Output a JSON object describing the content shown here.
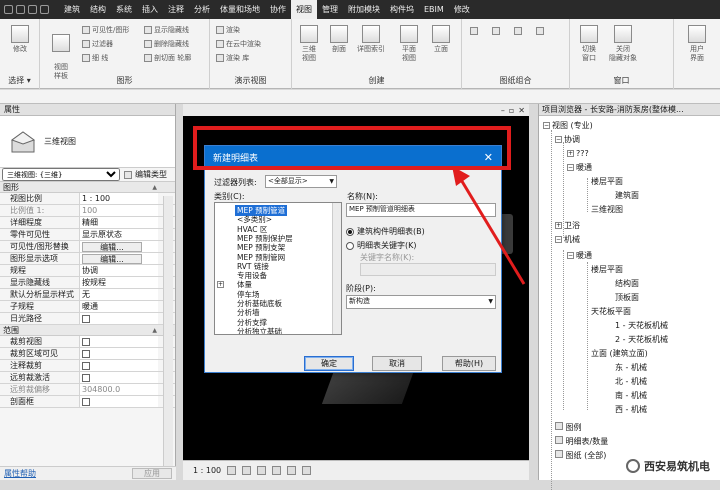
{
  "menubar": {
    "items": [
      "建筑",
      "结构",
      "系统",
      "插入",
      "注释",
      "分析",
      "体量和场地",
      "协作",
      "视图",
      "管理",
      "附加模块",
      "构件坞",
      "EBIM",
      "修改"
    ],
    "active": "视图"
  },
  "ribbon": {
    "modify": "修改",
    "select": "选择 ▾",
    "graphics": {
      "view_template": "视图\n样板",
      "visibility": "可见性/图形",
      "filters": "过滤器",
      "thin_lines": "细 线",
      "show_hidden": "显示隐藏线",
      "remove_hidden": "删除隐藏线",
      "cut_profile": "剖切面 轮廓",
      "label": "图形"
    },
    "presentation": {
      "render": "渲染",
      "render_cloud": "在云中渲染",
      "render_gallery": "渲染 库",
      "label": "演示视图"
    },
    "create": {
      "three_d": "三维\n视图",
      "section": "剖面",
      "callout": "详图索引",
      "plan_views": "平面\n视图",
      "elevation": "立面",
      "label": "创建"
    },
    "sheet": {
      "label": "图纸组合"
    },
    "window": {
      "switch": "切换\n窗口",
      "close_inactive": "关闭\n隐藏对象",
      "user_interface": "用户\n界面",
      "label": "窗口"
    }
  },
  "properties": {
    "title": "属性",
    "type_name": "三维视图",
    "selector": "三维视图: {三维}",
    "edit_type": "编辑类型",
    "group_graphics": "图形",
    "group_range": "范围",
    "rows_graphics": [
      {
        "k": "视图比例",
        "v": "1 : 100"
      },
      {
        "k": "比例值 1:",
        "v": "100"
      },
      {
        "k": "详细程度",
        "v": "精细"
      },
      {
        "k": "零件可见性",
        "v": "显示原状态"
      },
      {
        "k": "可见性/图形替换",
        "v": "编辑..."
      },
      {
        "k": "图形显示选项",
        "v": "编辑..."
      },
      {
        "k": "规程",
        "v": "协调"
      },
      {
        "k": "显示隐藏线",
        "v": "按规程"
      },
      {
        "k": "默认分析显示样式",
        "v": "无"
      },
      {
        "k": "子规程",
        "v": "暖通"
      },
      {
        "k": "日光路径",
        "v": ""
      }
    ],
    "rows_range": [
      {
        "k": "裁剪视图",
        "v": ""
      },
      {
        "k": "裁剪区域可见",
        "v": ""
      },
      {
        "k": "注释裁剪",
        "v": ""
      },
      {
        "k": "远剪裁激活",
        "v": ""
      },
      {
        "k": "远剪裁偏移",
        "v": "304800.0"
      },
      {
        "k": "剖面框",
        "v": ""
      }
    ],
    "help": "属性帮助",
    "apply": "应用"
  },
  "status": {
    "scale": "1 : 100"
  },
  "browser": {
    "title": "项目浏览器 - 长安路-消防泵房(整体模...",
    "nodes": {
      "views": "视图 (专业)",
      "coord": "协调",
      "q": "???",
      "hvac1": "暖通",
      "floorplan1": "楼层平面",
      "arch_plan": "建筑面",
      "view3d": "三维视图",
      "plumbing": "卫浴",
      "mech": "机械",
      "hvac2": "暖通",
      "floorplan2": "楼层平面",
      "struct_plan": "结构面",
      "roof_plan": "顶板面",
      "ceiling": "天花板平面",
      "ceil1": "1 - 天花板机械",
      "ceil2": "2 - 天花板机械",
      "elev": "立面 (建筑立面)",
      "east": "东 - 机械",
      "north": "北 - 机械",
      "south": "南 - 机械",
      "west": "西 - 机械",
      "legends": "图例",
      "schedules": "明细表/数量",
      "sheets": "图纸 (全部)"
    },
    "watermark": "西安易筑机电"
  },
  "dialog": {
    "title": "新建明细表",
    "filter_label": "过滤器列表:",
    "filter_value": "<全部显示>",
    "category_label": "类别(C):",
    "categories": [
      "MEP 预制管道",
      "<多类别>",
      "HVAC 区",
      "MEP 预制保护层",
      "MEP 预制支架",
      "MEP 预制管网",
      "RVT 链接",
      "专用设备",
      "体量",
      "停车场",
      "分析基础底板",
      "分析墙",
      "分析支撑",
      "分析独立基础"
    ],
    "name_label": "名称(N):",
    "name_value": "MEP 预制管道明细表",
    "radio1": "建筑构件明细表(B)",
    "radio2": "明细表关键字(K)",
    "key_name_label": "关键字名称(K):",
    "phase_label": "阶段(P):",
    "phase_value": "新构造",
    "ok": "确定",
    "cancel": "取消",
    "help": "帮助(H)"
  }
}
